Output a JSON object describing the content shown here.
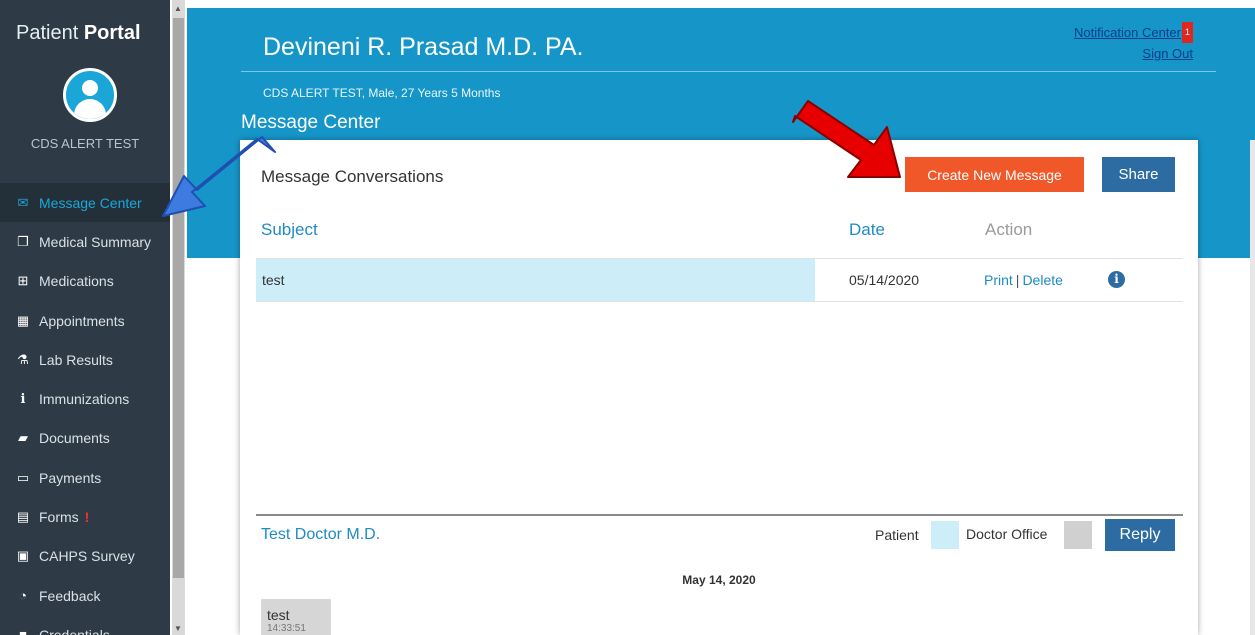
{
  "sidebar": {
    "brand_regular": "Patient ",
    "brand_bold": "Portal",
    "patient_name": "CDS ALERT TEST",
    "items": [
      {
        "label": "Message Center",
        "icon": "envelope-icon"
      },
      {
        "label": "Medical Summary",
        "icon": "copy-icon"
      },
      {
        "label": "Medications",
        "icon": "medkit-icon"
      },
      {
        "label": "Appointments",
        "icon": "calendar-icon"
      },
      {
        "label": "Lab Results",
        "icon": "flask-icon"
      },
      {
        "label": "Immunizations",
        "icon": "info-icon"
      },
      {
        "label": "Documents",
        "icon": "folder-open-icon"
      },
      {
        "label": "Payments",
        "icon": "credit-card-icon"
      },
      {
        "label": "Forms",
        "icon": "file-text-icon"
      },
      {
        "label": "CAHPS Survey",
        "icon": "survey-icon"
      },
      {
        "label": "Feedback",
        "icon": "comments-icon"
      },
      {
        "label": "Credentials",
        "icon": "key-icon"
      }
    ],
    "forms_alert": "!"
  },
  "header": {
    "practice_name": "Devineni R. Prasad M.D. PA.",
    "patient_info": "CDS ALERT TEST,  Male,  27 Years 5 Months",
    "section_title": "Message Center",
    "notification_link": "Notification Center",
    "notification_count": "1",
    "signout_link": "Sign Out"
  },
  "card": {
    "title": "Message Conversations",
    "create_button": "Create New Message",
    "share_button": "Share",
    "columns": {
      "subject": "Subject",
      "date": "Date",
      "action": "Action"
    },
    "rows": [
      {
        "subject": "test",
        "date": "05/14/2020",
        "print": "Print",
        "sep": "|",
        "delete": "Delete"
      }
    ]
  },
  "conversation": {
    "doctor": "Test Doctor M.D.",
    "legend_patient": "Patient",
    "legend_office": "Doctor Office",
    "reply_button": "Reply",
    "date": "May 14, 2020",
    "message_text": "test",
    "message_time": "14:33:51"
  },
  "colors": {
    "sidebar_bg": "#2e3a45",
    "header_bg": "#1696c8",
    "accent": "#1aa7d8",
    "create_button": "#f0582a",
    "primary_button": "#2d6ca2",
    "patient_swatch": "#cdeef9",
    "office_swatch": "#d0d0d0",
    "annotation_blue": "#3d7be0",
    "annotation_red": "#e60000"
  }
}
